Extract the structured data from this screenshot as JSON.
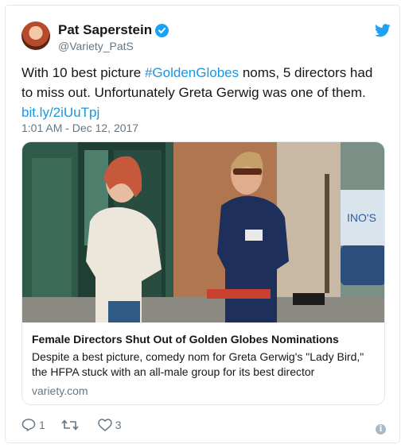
{
  "user": {
    "display_name": "Pat Saperstein",
    "handle": "@Variety_PatS",
    "verified": true
  },
  "tweet": {
    "text_part1": "With 10 best picture ",
    "hashtag": "#GoldenGlobes",
    "text_part2": " noms, 5 directors had to miss out. Unfortunately Greta Gerwig was one of them.",
    "link": "bit.ly/2iUuTpj",
    "timestamp": "1:01 AM - Dec 12, 2017"
  },
  "card": {
    "title": "Female Directors Shut Out of Golden Globes Nominations",
    "description": "Despite a best picture, comedy nom for Greta Gerwig's \"Lady Bird,\" the HFPA stuck with an all-male group for its best director",
    "domain": "variety.com",
    "image_sign_text": "INO'S"
  },
  "actions": {
    "replies": "1",
    "retweets": "",
    "likes": "3"
  },
  "icons": [
    "twitter-bird-icon",
    "verified-badge-icon",
    "reply-icon",
    "retweet-icon",
    "like-icon",
    "info-icon"
  ],
  "colors": {
    "brand_blue": "#1da1f2",
    "link_blue": "#1b95e0",
    "muted_gray": "#657786",
    "border": "#e1e8ed"
  }
}
